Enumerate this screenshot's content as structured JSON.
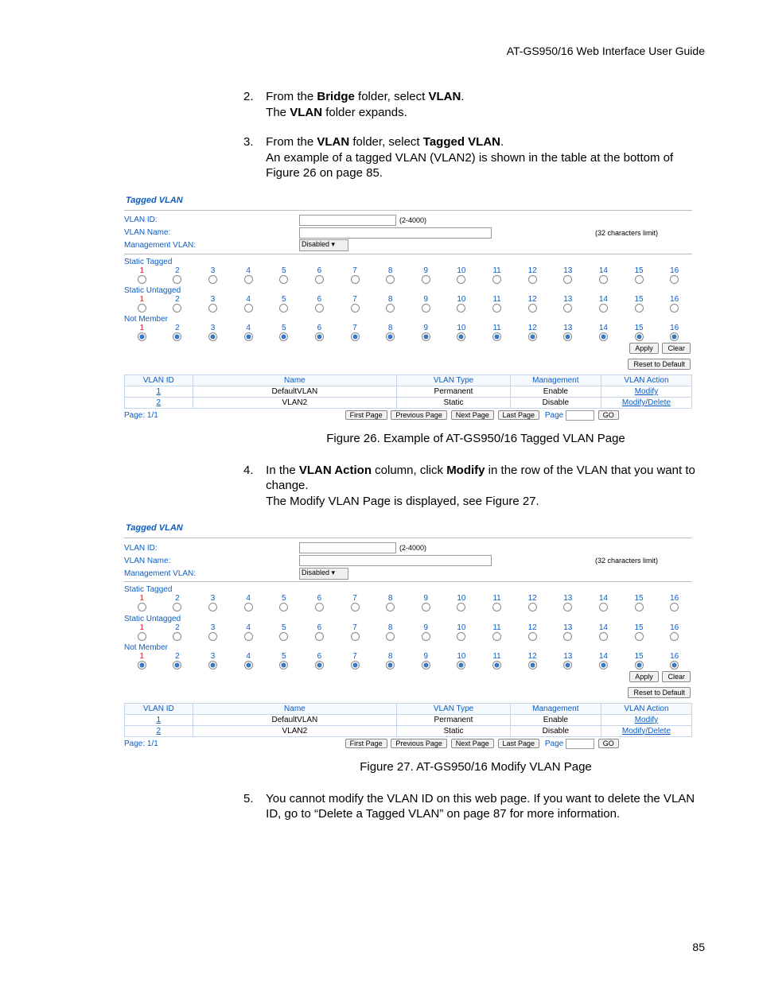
{
  "header": "AT-GS950/16  Web Interface User Guide",
  "page_number": "85",
  "steps": {
    "s2": {
      "num": "2.",
      "l1a": "From the ",
      "l1b": "Bridge",
      "l1c": " folder, select ",
      "l1d": "VLAN",
      "l1e": ".",
      "l2a": "The ",
      "l2b": "VLAN",
      "l2c": " folder expands."
    },
    "s3": {
      "num": "3.",
      "l1a": "From the ",
      "l1b": "VLAN",
      "l1c": " folder, select ",
      "l1d": "Tagged VLAN",
      "l1e": ".",
      "l2": "An example of a tagged VLAN (VLAN2) is shown in the table at the bottom of Figure 26 on page 85."
    },
    "s4": {
      "num": "4.",
      "l1a": "In the ",
      "l1b": "VLAN Action",
      "l1c": " column, click ",
      "l1d": "Modify",
      "l1e": " in the row of the VLAN that you want to change.",
      "l2": "The Modify VLAN Page is displayed, see Figure 27."
    },
    "s5": {
      "num": "5.",
      "l1": "You cannot modify the VLAN ID on this web page. If you want to delete the VLAN ID, go to “Delete a Tagged VLAN” on page 87 for more information."
    }
  },
  "captions": {
    "fig26": "Figure 26. Example of AT-GS950/16 Tagged VLAN Page",
    "fig27": "Figure 27. AT-GS950/16 Modify VLAN Page"
  },
  "shot": {
    "title": "Tagged VLAN",
    "vlan_id_label": "VLAN ID:",
    "vlan_id_hint": "(2-4000)",
    "vlan_name_label": "VLAN Name:",
    "vlan_name_hint": "(32 characters limit)",
    "mgmt_label": "Management VLAN:",
    "mgmt_value": "Disabled",
    "sections": {
      "tagged": "Static Tagged",
      "untagged": "Static Untagged",
      "not": "Not Member"
    },
    "ports": [
      "1",
      "2",
      "3",
      "4",
      "5",
      "6",
      "7",
      "8",
      "9",
      "10",
      "11",
      "12",
      "13",
      "14",
      "15",
      "16"
    ],
    "buttons": {
      "apply": "Apply",
      "clear": "Clear",
      "reset": "Reset to Default",
      "first": "First Page",
      "prev": "Previous Page",
      "next": "Next Page",
      "last": "Last Page",
      "go": "GO"
    },
    "table": {
      "headers": [
        "VLAN ID",
        "Name",
        "VLAN Type",
        "Management",
        "VLAN Action"
      ],
      "rows": [
        {
          "id": "1",
          "name": "DefaultVLAN",
          "type": "Permanent",
          "mgmt": "Enable",
          "action": "Modify"
        },
        {
          "id": "2",
          "name": "VLAN2",
          "type": "Static",
          "mgmt": "Disable",
          "action": "Modify/Delete"
        }
      ]
    },
    "pager_label": "Page:  1/1",
    "page_word": "Page"
  },
  "fig26_state": {
    "tagged_selected": null,
    "untagged_selected": null,
    "not_member_first_selected": true
  },
  "fig27_state": {
    "tagged_selected": null,
    "untagged_selected": null,
    "not_member_first_selected": true
  }
}
